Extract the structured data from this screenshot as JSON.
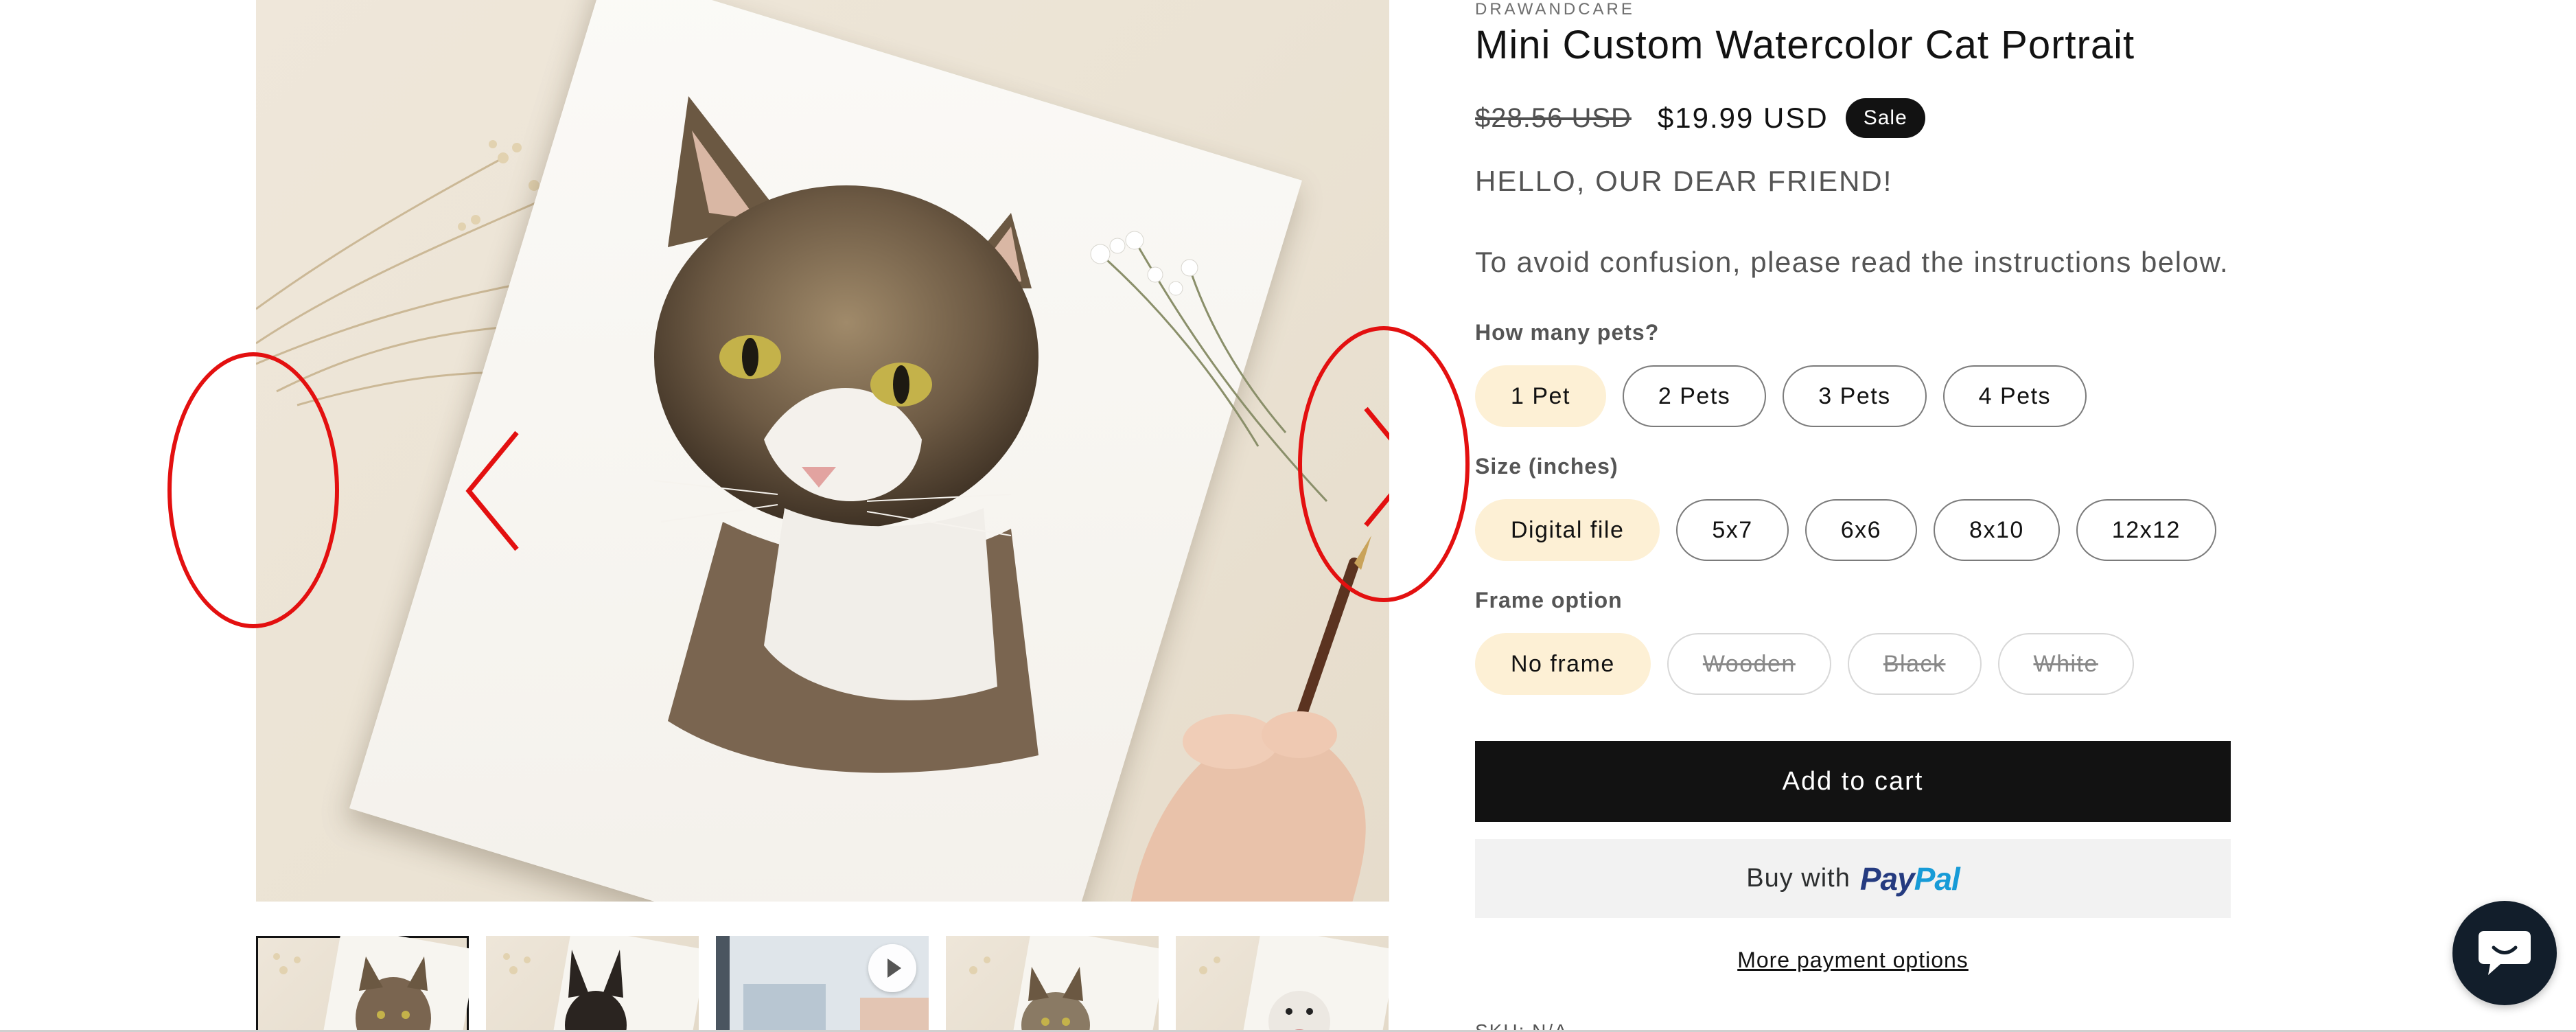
{
  "product": {
    "vendor": "DRAWANDCARE",
    "title": "Mini Custom Watercolor Cat Portrait",
    "price_old": "$28.56 USD",
    "price_new": "$19.99 USD",
    "sale_badge": "Sale",
    "hello": "HELLO, OUR DEAR FRIEND!",
    "instructions": "To avoid confusion, please read the instructions below."
  },
  "options": {
    "pets": {
      "label": "How many pets?",
      "values": [
        "1 Pet",
        "2 Pets",
        "3 Pets",
        "4 Pets"
      ],
      "selected": "1 Pet"
    },
    "size": {
      "label": "Size (inches)",
      "values": [
        "Digital file",
        "5x7",
        "6x6",
        "8x10",
        "12x12"
      ],
      "selected": "Digital file"
    },
    "frame": {
      "label": "Frame option",
      "values": [
        "No frame",
        "Wooden",
        "Black",
        "White"
      ],
      "selected": "No frame",
      "unavailable": [
        "Wooden",
        "Black",
        "White"
      ]
    }
  },
  "actions": {
    "add_to_cart": "Add to cart",
    "buy_with": "Buy with",
    "paypal_pay": "Pay",
    "paypal_pal": "Pal",
    "more_payment": "More payment options"
  },
  "sku_peek": "SKU: N/A",
  "gallery": {
    "main_image": "watercolor-cat-portrait",
    "thumbnails": [
      "tabby-cat-portrait",
      "black-dog-portrait",
      "video-thumbnail",
      "kitten-portrait",
      "white-dog-portrait"
    ],
    "active_thumbnail": 0,
    "video_thumbnail_index": 2
  },
  "icons": {
    "prev": "chevron-left-icon",
    "next": "chevron-right-icon",
    "play": "play-icon",
    "chat": "chat-icon"
  },
  "colors": {
    "accent": "#121212",
    "selected_pill": "#fdf0d5",
    "annotation": "#e31010",
    "paypal_dark": "#253b80",
    "paypal_light": "#179bd7",
    "chat_bg": "#121e2b"
  }
}
